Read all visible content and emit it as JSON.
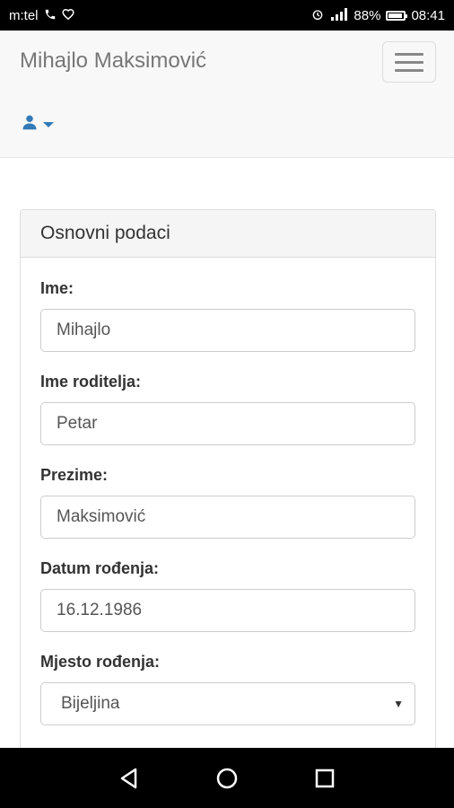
{
  "status_bar": {
    "carrier": "m:tel",
    "battery_percent": "88%",
    "time": "08:41",
    "icons": [
      "phone-icon",
      "heart-icon",
      "alarm-icon",
      "signal-icon",
      "battery-icon"
    ]
  },
  "navbar": {
    "brand": "Mihajlo Maksimović",
    "toggle_icon": "hamburger-icon",
    "user_icon": "user-icon",
    "accent_color": "#337ab7"
  },
  "panel": {
    "title": "Osnovni podaci",
    "fields": [
      {
        "label": "Ime:",
        "value": "Mihajlo"
      },
      {
        "label": "Ime roditelja:",
        "value": "Petar"
      },
      {
        "label": "Prezime:",
        "value": "Maksimović"
      },
      {
        "label": "Datum rođenja:",
        "value": "16.12.1986"
      },
      {
        "label": "Mjesto rođenja:",
        "value": "Bijeljina"
      }
    ]
  },
  "system_nav": {
    "back": "back-icon",
    "home": "home-icon",
    "recents": "recents-icon"
  }
}
